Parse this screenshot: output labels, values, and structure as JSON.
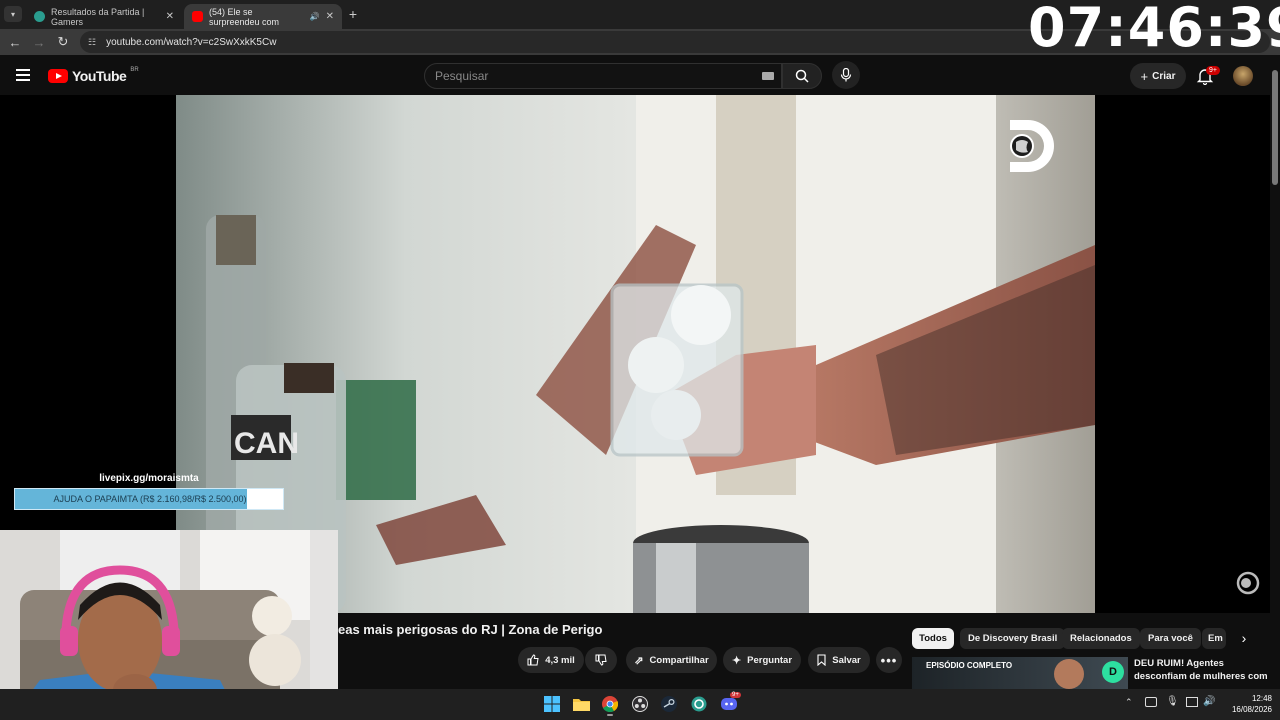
{
  "overlay_clock": "07:46:39",
  "browser": {
    "tabs": [
      {
        "label": "Resultados da Partida | Gamers",
        "favicon_color": "#2a9d8f"
      },
      {
        "label": "(54) Ele se surpreendeu com",
        "favicon_color": "#ff0000"
      }
    ],
    "new_tab_label": "+",
    "url": "youtube.com/watch?v=c2SwXxkK5Cw"
  },
  "youtube": {
    "logo_text": "YouTube",
    "logo_country": "BR",
    "search_placeholder": "Pesquisar",
    "create_label": "Criar",
    "notification_badge": "9+"
  },
  "video": {
    "bottle_label": "CAN",
    "channel_logo": "discovery-logo"
  },
  "livepix": {
    "url": "livepix.gg/moraismta",
    "goal_text": "AJUDA O PAPAIMTA (R$ 2.160,98/R$ 2.500,00)",
    "progress_fraction": 0.864
  },
  "watch": {
    "title": "eas mais perigosas do RJ | Zona de Perigo",
    "actions": {
      "like_count": "4,3 mil",
      "share": "Compartilhar",
      "ask": "Perguntar",
      "save": "Salvar"
    }
  },
  "chips": [
    "Todos",
    "De Discovery Brasil",
    "Relacionados",
    "Para você",
    "Em"
  ],
  "recommendation": {
    "badge": "EPISÓDIO COMPLETO",
    "title_line1": "DEU RUIM! Agentes",
    "title_line2": "desconfiam de mulheres com"
  },
  "system": {
    "time": "12:48",
    "date": "16/08/2026",
    "discord_badge": "9+"
  },
  "colors": {
    "youtube_red": "#ff0000",
    "background": "#0f0f0f",
    "pix_fill": "#64b5d9"
  }
}
